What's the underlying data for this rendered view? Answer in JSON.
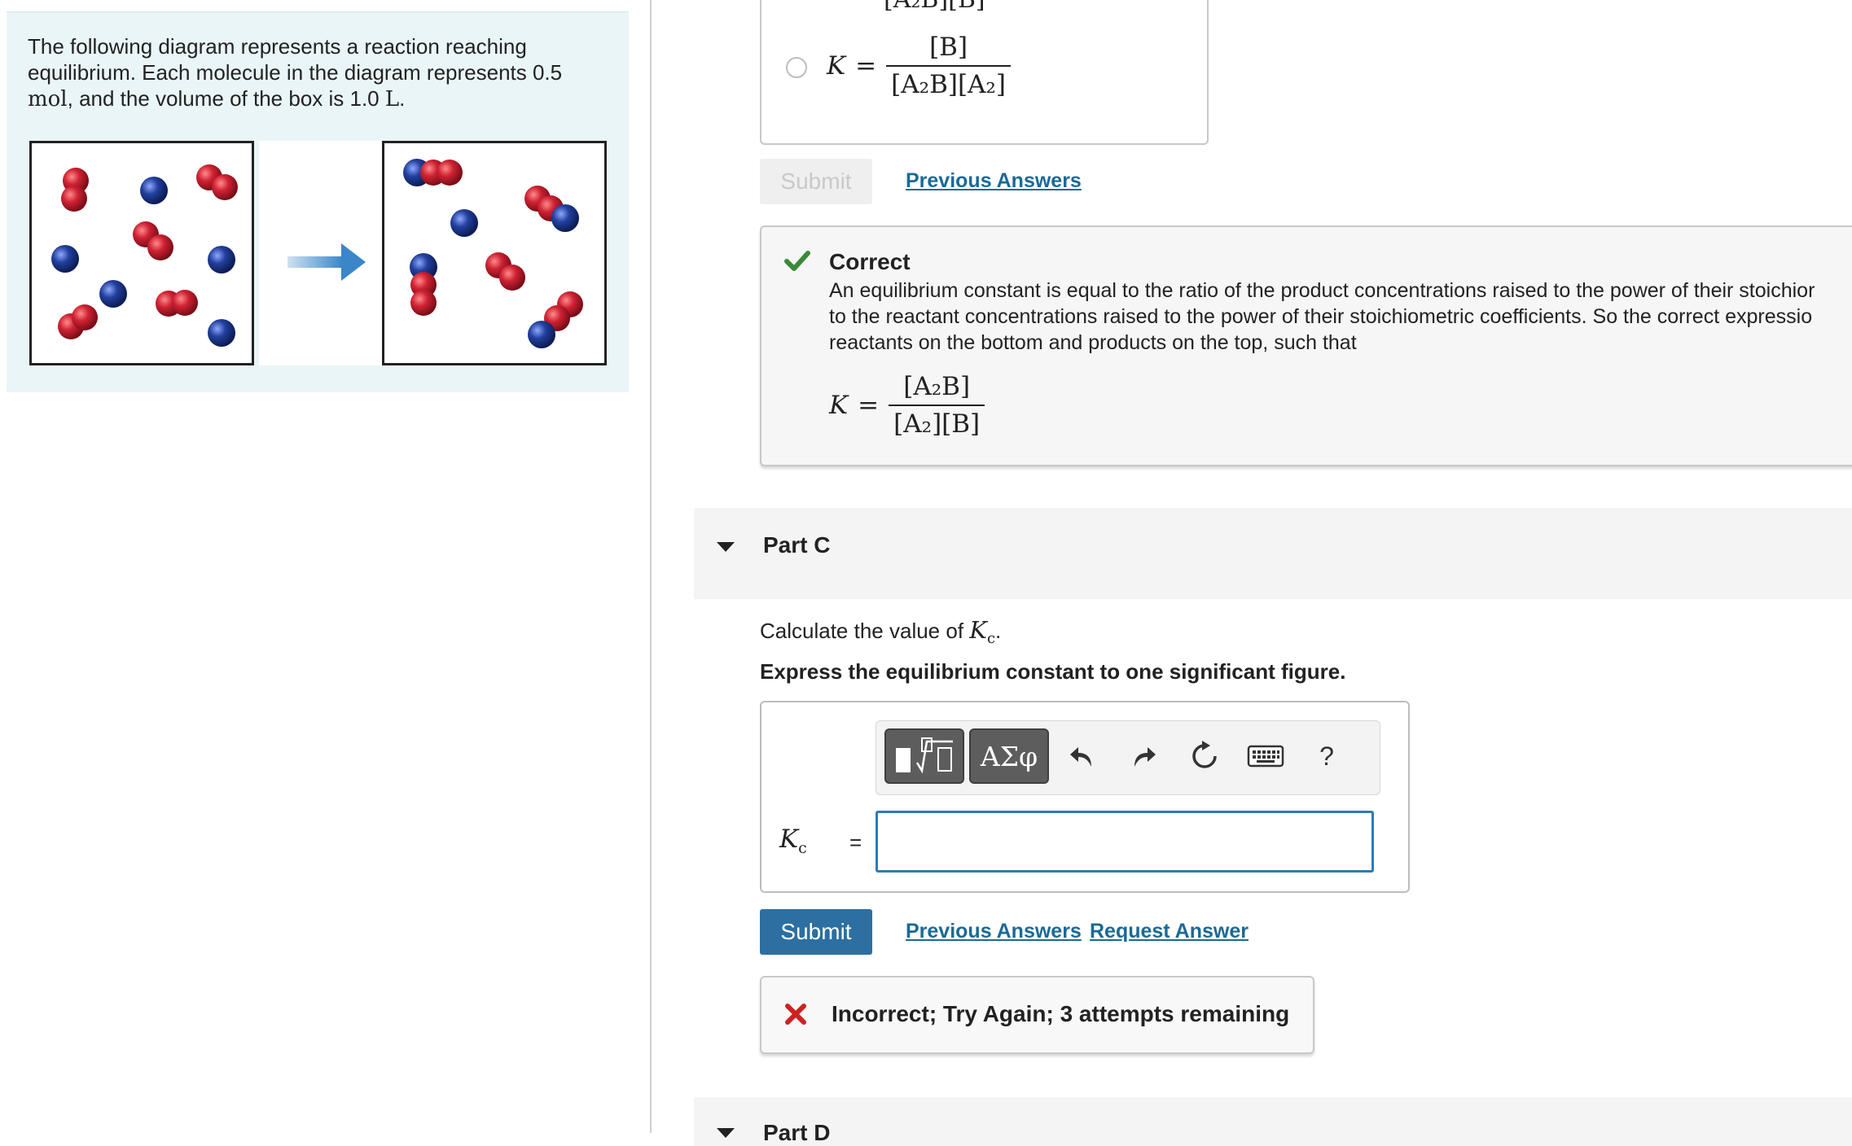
{
  "problem": {
    "text_1": "The following diagram represents a reaction reaching equilibrium. Each molecule in the diagram represents 0.5 ",
    "unit_mol": "mol",
    "text_2": ", and the volume of the box is 1.0 ",
    "unit_L": "L",
    "text_3": "."
  },
  "part_b": {
    "partial_denominator": "[A₂B][B]",
    "choice_K": "K",
    "choice_eq": "=",
    "choice_numerator": "[B]",
    "choice_denominator": "[A₂B][A₂]",
    "submit_label": "Submit",
    "previous_answers_label": "Previous Answers",
    "feedback": {
      "title": "Correct",
      "body_line_1": "An equilibrium constant is equal to the ratio of the product concentrations raised to the power of their stoichior",
      "body_line_2": "to the reactant concentrations raised to the power of their stoichiometric coefficients. So the correct expressio",
      "body_line_3": "reactants on the bottom and products on the top, such that",
      "eq_K": "K",
      "eq_sign": "=",
      "eq_numerator": "[A₂B]",
      "eq_denominator": "[A₂][B]"
    }
  },
  "part_c": {
    "title": "Part C",
    "question_prefix": "Calculate the value of ",
    "question_symbol": "K",
    "question_sub": "c",
    "question_suffix": ".",
    "instruction": "Express the equilibrium constant to one significant figure.",
    "toolbar": {
      "greek_label": "ΑΣφ",
      "help_label": "?"
    },
    "answer_label": "K",
    "answer_label_sub": "c",
    "answer_equals": "=",
    "answer_value": "",
    "submit_label": "Submit",
    "previous_answers_label": "Previous Answers",
    "request_answer_label": "Request Answer",
    "feedback": {
      "title": "Incorrect; Try Again; 3 attempts remaining"
    }
  },
  "part_d": {
    "title": "Part D"
  },
  "colors": {
    "accent": "#2c6fa0",
    "link": "#1b6a95",
    "correct": "#3a8a3a",
    "incorrect": "#cc2222",
    "red_atom": "#c8202e",
    "blue_atom": "#1e3f9a",
    "panel_bg": "#eaf5f7"
  }
}
